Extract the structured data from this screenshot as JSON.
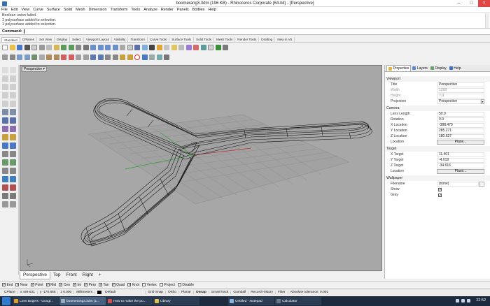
{
  "window": {
    "title": "boomerang3.3dm (196 KB) - Rhinoceros Corporate (64-bit) - [Perspective]"
  },
  "menu": [
    "File",
    "Edit",
    "View",
    "Curve",
    "Surface",
    "Solid",
    "Mesh",
    "Dimension",
    "Transform",
    "Tools",
    "Analyze",
    "Render",
    "Panels",
    "Boltiles",
    "Help"
  ],
  "history": [
    "Boolean union failed.",
    "1 polysurface added to selection.",
    "1 polysurface added to selection."
  ],
  "command": {
    "label": "Command:"
  },
  "toolbar_tabs": [
    "Standard",
    "CPlanes",
    "Set View",
    "Display",
    "Select",
    "Viewport Layout",
    "Visibility",
    "Transform",
    "Curve Tools",
    "Surface Tools",
    "Solid Tools",
    "Mesh Tools",
    "Render Tools",
    "Drafting",
    "New in V5"
  ],
  "viewport": {
    "label": "Perspective",
    "label_arrow": "▾"
  },
  "viewport_tabs": [
    "Perspective",
    "Top",
    "Front",
    "Right",
    "+"
  ],
  "osnap": [
    {
      "label": "End",
      "checked": true
    },
    {
      "label": "Near",
      "checked": true
    },
    {
      "label": "Point",
      "checked": true
    },
    {
      "label": "Mid",
      "checked": true
    },
    {
      "label": "Cen",
      "checked": true
    },
    {
      "label": "Int",
      "checked": true
    },
    {
      "label": "Perp",
      "checked": true
    },
    {
      "label": "Tan",
      "checked": true
    },
    {
      "label": "Quad",
      "checked": true
    },
    {
      "label": "Knot",
      "checked": true
    },
    {
      "label": "Vertex",
      "checked": false
    },
    {
      "label": "Project",
      "checked": false
    },
    {
      "label": "Disable",
      "checked": false
    }
  ],
  "status": {
    "cplane": "CPlane",
    "x": "x 449.631",
    "y": "y -170.555",
    "z": "z 0.000",
    "units": "Millimeters",
    "layer": "Default",
    "toggles": [
      "Grid Snap",
      "Ortho",
      "Planar",
      "Osnap",
      "SmartTrack",
      "Gumball",
      "Record History",
      "Filter"
    ],
    "tolerance": "Absolute tolerance: 0.001"
  },
  "panel": {
    "tabs": [
      "Properties",
      "Layers",
      "Display",
      "Help"
    ],
    "sections": {
      "viewport": "Viewport",
      "camera": "Camera",
      "target": "Target",
      "wallpaper": "Wallpaper"
    },
    "viewport_rows": {
      "title_k": "Title",
      "title_v": "Perspective",
      "width_k": "Width",
      "width_v": "1288",
      "height_k": "Height",
      "height_v": "711",
      "projection_k": "Projection",
      "projection_v": "Perspective"
    },
    "camera_rows": {
      "lens_k": "Lens Length",
      "lens_v": "50.0",
      "rotation_k": "Rotation",
      "rotation_v": "0.0",
      "xloc_k": "X Location",
      "xloc_v": "-388.475",
      "yloc_k": "Y Location",
      "yloc_v": "285.271",
      "zloc_k": "Z Location",
      "zloc_v": "180.627",
      "location_k": "Location",
      "place_btn": "Place..."
    },
    "target_rows": {
      "xt_k": "X Target",
      "xt_v": "11.401",
      "yt_k": "Y Target",
      "yt_v": "-4.019",
      "zt_k": "Z Target",
      "zt_v": "-34.616",
      "location_k": "Location",
      "place_btn": "Place..."
    },
    "wallpaper_rows": {
      "filename_k": "Filename",
      "filename_v": "(none)",
      "show_k": "Show",
      "gray_k": "Gray"
    }
  },
  "taskbar": {
    "items": [
      "Loes Bogers - Googl...",
      "boomerang3.3dm (1...",
      "How to make the po...",
      "Library",
      "Untitled - Notepad",
      "Calculator"
    ],
    "clock": "22:52"
  },
  "colors": {
    "viewport_bg": "#a7a7a7",
    "taskbar_bg": "#1c2a3e",
    "axis_x": "#c03030",
    "axis_y": "#30a030"
  }
}
